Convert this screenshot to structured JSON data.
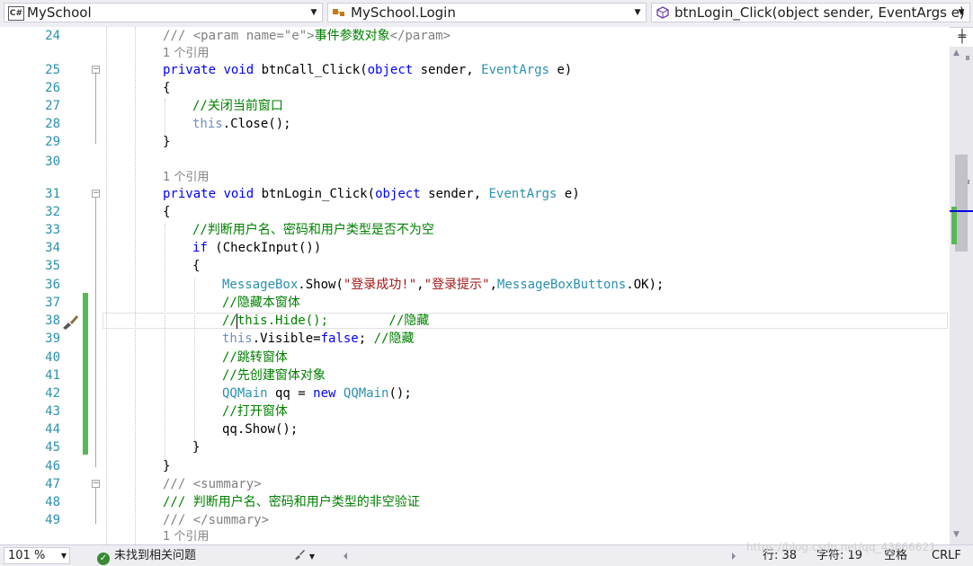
{
  "navbar": {
    "project": {
      "icon_label": "C#",
      "label": "MySchool"
    },
    "type": {
      "label": "MySchool.Login"
    },
    "member": {
      "label": "btnLogin_Click(object sender, EventArgs e)"
    }
  },
  "editor": {
    "refs": {
      "a": "1 个引用",
      "b": "1 个引用",
      "c": "1 个引用"
    },
    "line_numbers": [
      "24",
      "25",
      "26",
      "27",
      "28",
      "29",
      "30",
      "31",
      "32",
      "33",
      "34",
      "35",
      "36",
      "37",
      "38",
      "39",
      "40",
      "41",
      "42",
      "43",
      "44",
      "45",
      "46",
      "47",
      "48",
      "49"
    ],
    "code": {
      "l24": {
        "a": "/// <param name=\"e\">",
        "b": "事件参数对象",
        "c": "</param>"
      },
      "l25": {
        "kw1": "private",
        "kw2": "void",
        "name": "btnCall_Click",
        "kw3": "object",
        "p1": " sender, ",
        "ty": "EventArgs",
        "p2": " e)"
      },
      "l26": "{",
      "l27": "//关闭当前窗口",
      "l28": {
        "ths": "this",
        "rest": ".Close();"
      },
      "l29": "}",
      "l31": {
        "kw1": "private",
        "kw2": "void",
        "name": "btnLogin_Click",
        "kw3": "object",
        "p1": " sender, ",
        "ty": "EventArgs",
        "p2": " e)"
      },
      "l32": "{",
      "l33": "//判断用户名、密码和用户类型是否不为空",
      "l34": {
        "kw": "if",
        "rest": " (CheckInput())"
      },
      "l35": "{",
      "l36": {
        "ty1": "MessageBox",
        "a": ".Show(",
        "s1": "\"登录成功!\"",
        "b": ",",
        "s2": "\"登录提示\"",
        "c": ",",
        "ty2": "MessageBoxButtons",
        "d": ".OK);"
      },
      "l37": "//隐藏本窗体",
      "l38": "//this.Hide();        //隐藏",
      "l39": {
        "ths": "this",
        "a": ".Visible=",
        "kw": "false",
        "b": "; ",
        "cm": "//隐藏"
      },
      "l40": "//跳转窗体",
      "l41": "//先创建窗体对象",
      "l42": {
        "ty1": "QQMain",
        "a": " qq = ",
        "kw": "new",
        "b": " ",
        "ty2": "QQMain",
        "c": "();"
      },
      "l43": "//打开窗体",
      "l44": "qq.Show();",
      "l45": "}",
      "l46": "}",
      "l47": {
        "a": "/// ",
        "b": "<summary>"
      },
      "l48": "/// 判断用户名、密码和用户类型的非空验证",
      "l49": {
        "a": "/// ",
        "b": "</summary>"
      }
    }
  },
  "statusbar": {
    "zoom": "101 %",
    "issues": "未找到相关问题",
    "row": "行: 38",
    "col": "字符: 19",
    "indent": "空格",
    "eol": "CRLF"
  },
  "watermark": "https://blog.csdn.net/qq_43666621",
  "colors": {
    "keyword": "#0000ff",
    "comment": "#008000",
    "type": "#2b91af",
    "string": "#a31515",
    "change_bar": "#57b857"
  }
}
